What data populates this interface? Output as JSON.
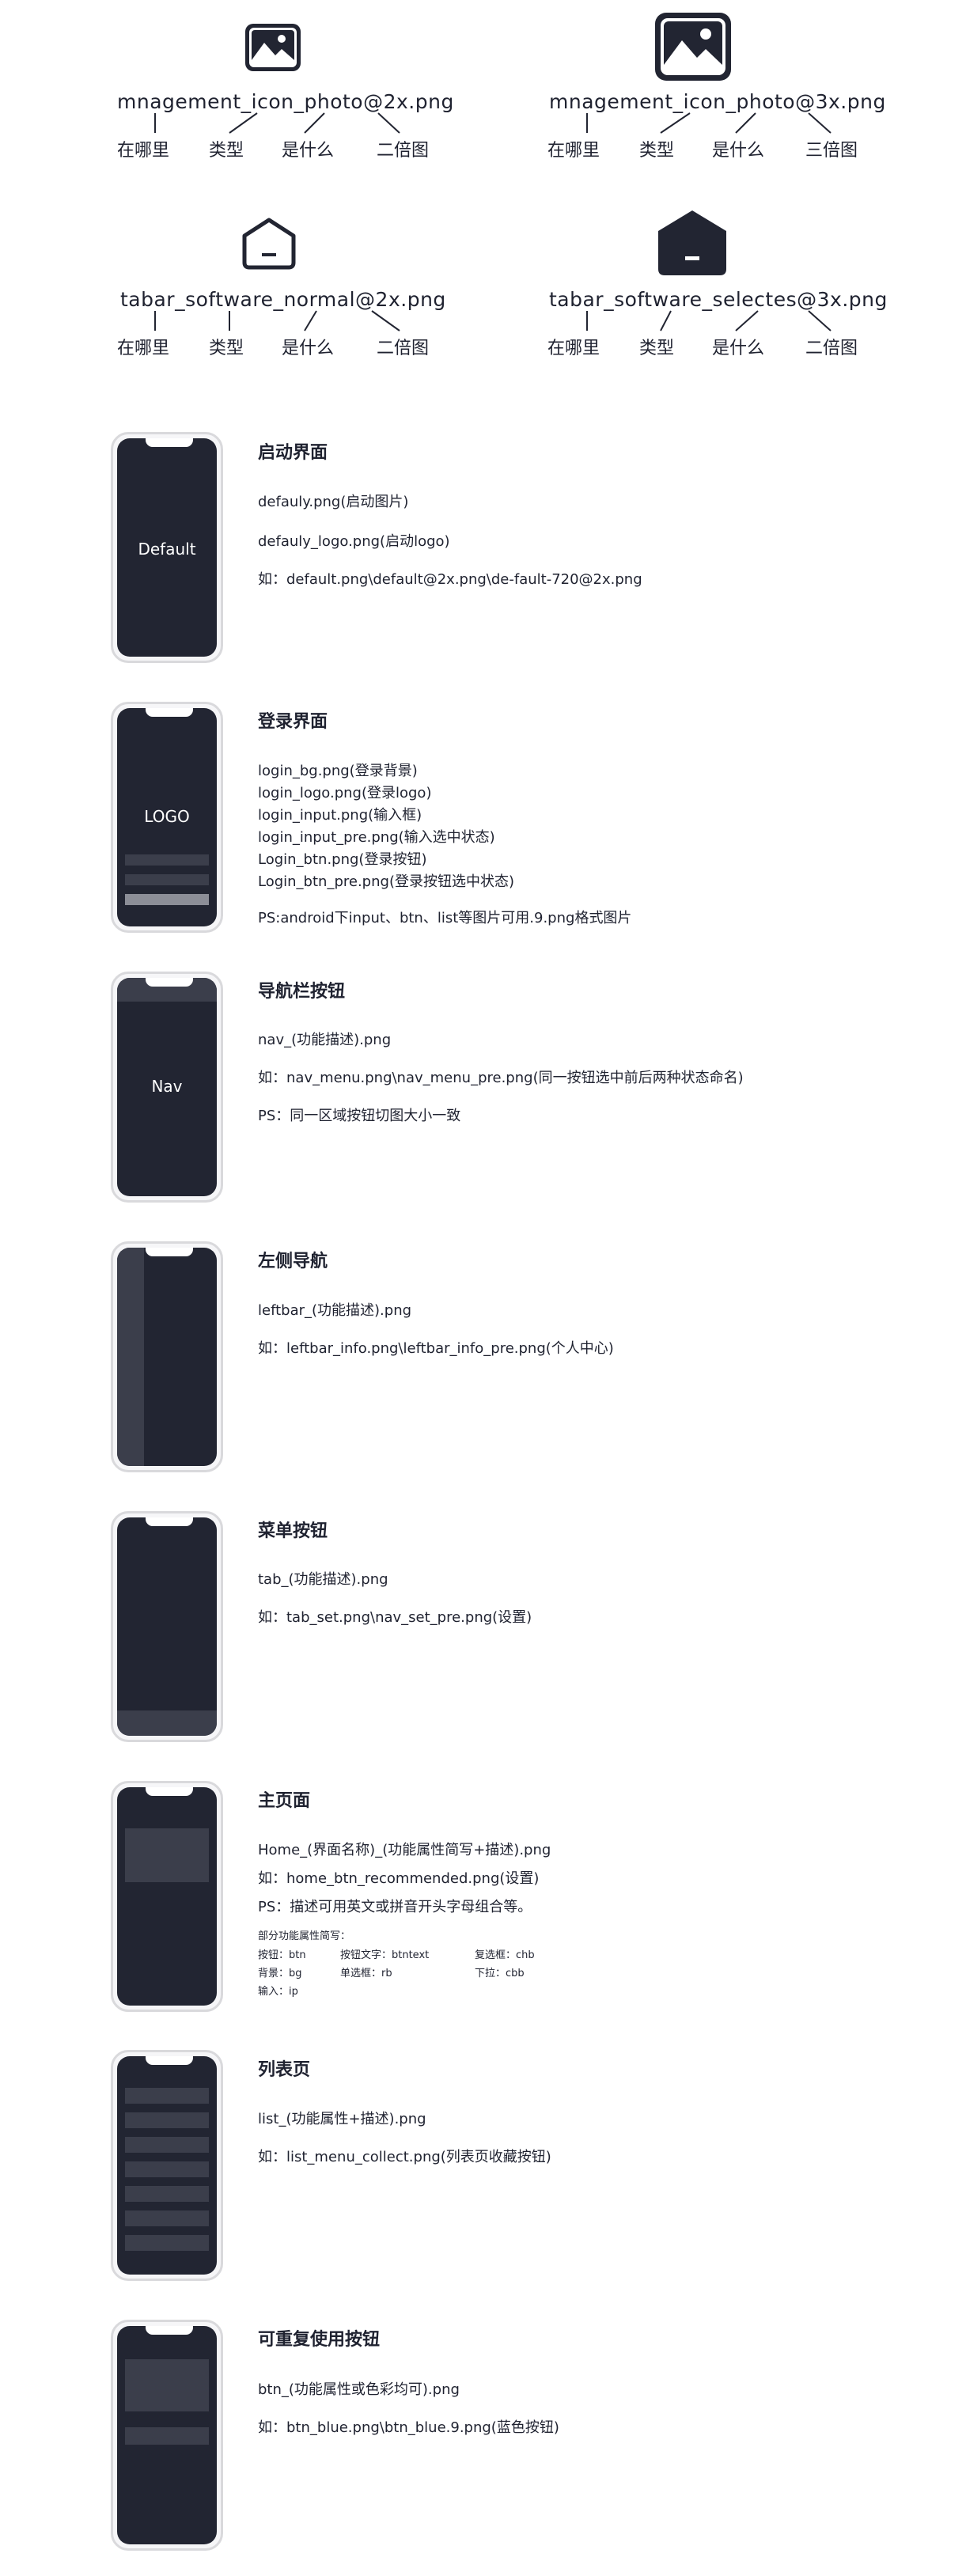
{
  "icons": [
    {
      "filename": "mnagement_icon_photo@2x.png",
      "labels": [
        "在哪里",
        "类型",
        "是什么",
        "二倍图"
      ],
      "icon": "image-icon"
    },
    {
      "filename": "mnagement_icon_photo@3x.png",
      "labels": [
        "在哪里",
        "类型",
        "是什么",
        "三倍图"
      ],
      "icon": "image-icon"
    },
    {
      "filename": "tabar_software_normal@2x.png",
      "labels": [
        "在哪里",
        "类型",
        "是什么",
        "二倍图"
      ],
      "icon": "home-outline-icon"
    },
    {
      "filename": "tabar_software_selectes@3x.png",
      "labels": [
        "在哪里",
        "类型",
        "是什么",
        "二倍图"
      ],
      "icon": "home-filled-icon"
    }
  ],
  "sections": [
    {
      "title": "启动界面",
      "screen_text": "Default",
      "lines": [
        "defauly.png(启动图片)",
        "defauly_logo.png(启动logo)",
        "如：default.png\\default@2x.png\\de-fault-720@2x.png"
      ]
    },
    {
      "title": "登录界面",
      "screen_text": "LOGO",
      "lines": [
        "login_bg.png(登录背景)",
        "login_logo.png(登录logo)",
        "login_input.png(输入框)",
        "login_input_pre.png(输入选中状态)",
        "Login_btn.png(登录按钮)",
        "Login_btn_pre.png(登录按钮选中状态)",
        "PS:android下input、btn、list等图片可用.9.png格式图片"
      ]
    },
    {
      "title": "导航栏按钮",
      "screen_text": "Nav",
      "lines": [
        "nav_(功能描述).png",
        "如：nav_menu.png\\nav_menu_pre.png(同一按钮选中前后两种状态命名)",
        "PS：同一区域按钮切图大小一致"
      ]
    },
    {
      "title": "左侧导航",
      "screen_text": "",
      "lines": [
        "leftbar_(功能描述).png",
        "如：leftbar_info.png\\leftbar_info_pre.png(个人中心)"
      ]
    },
    {
      "title": "菜单按钮",
      "screen_text": "",
      "lines": [
        "tab_(功能描述).png",
        "如：tab_set.png\\nav_set_pre.png(设置)"
      ]
    },
    {
      "title": "主页面",
      "screen_text": "",
      "lines": [
        "Home_(界面名称)_(功能属性简写+描述).png",
        "如：home_btn_recommended.png(设置)",
        "PS：描述可用英文或拼音开头字母组合等。"
      ],
      "abbr": {
        "heading": "部分功能属性简写：",
        "items": [
          "按钮：btn",
          "按钮文字：btntext",
          "复选框：chb",
          "背景：bg",
          "单选框：rb",
          "下拉：cbb",
          "输入：ip"
        ]
      }
    },
    {
      "title": "列表页",
      "screen_text": "",
      "lines": [
        "list_(功能属性+描述).png",
        "如：list_menu_collect.png(列表页收藏按钮)"
      ]
    },
    {
      "title": "可重复使用按钮",
      "screen_text": "",
      "lines": [
        "btn_(功能属性或色彩均可).png",
        "如：btn_blue.png\\btn_blue.9.png(蓝色按钮)"
      ]
    }
  ],
  "colors": {
    "dark": "#222532",
    "panel": "#3b3e4b",
    "bezel": "#d9d9dc"
  }
}
